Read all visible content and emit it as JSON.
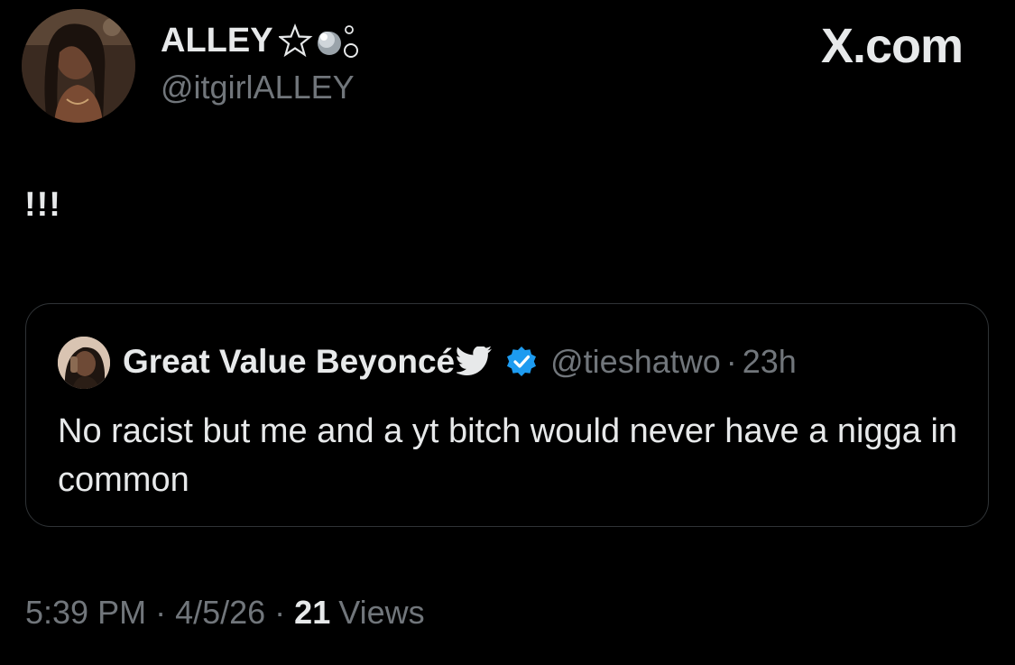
{
  "author": {
    "display_name": "ALLEY",
    "handle": "@itgirlALLEY"
  },
  "brand": {
    "logo_text": "X.com"
  },
  "tweet": {
    "text": "!!!"
  },
  "quoted_tweet": {
    "display_name": "Great Value Beyoncé",
    "handle": "@tieshatwo",
    "separator": "·",
    "age": "23h",
    "text": "No racist but me and a yt bitch would never have a nigga in common",
    "verified_color": "#1d9bf0"
  },
  "meta": {
    "time": "5:39 PM",
    "separator": "·",
    "date": "4/5/26",
    "views_count": "21",
    "views_label": "Views"
  },
  "icons": {
    "name_decoration": "star-bubbles-icon",
    "quoted_name_decoration": "bird-icon",
    "verified": "verified-badge-icon"
  }
}
